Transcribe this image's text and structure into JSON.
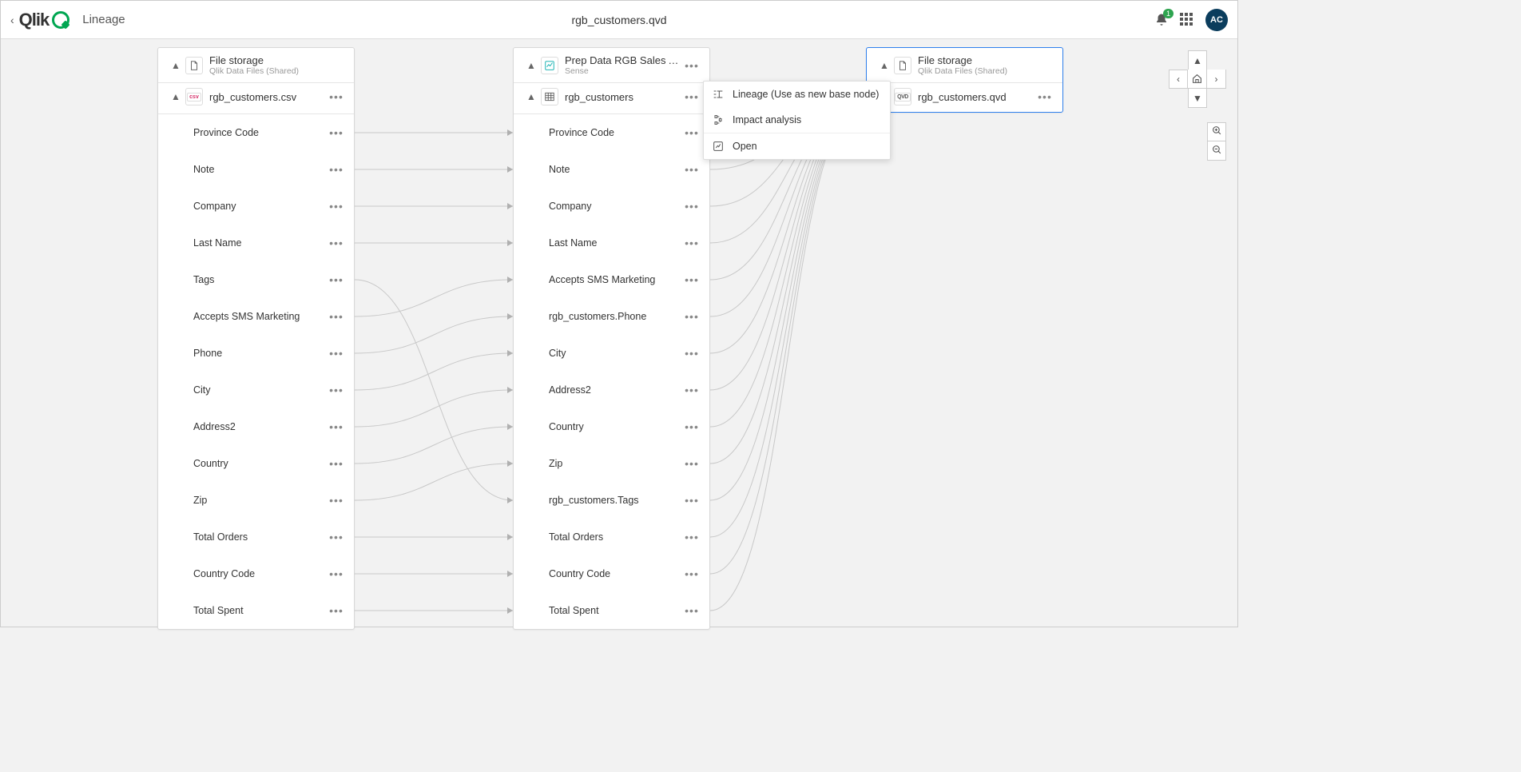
{
  "header": {
    "page_title": "Lineage",
    "document_title": "rgb_customers.qvd",
    "notification_count": "1",
    "avatar_initials": "AC"
  },
  "context_menu": {
    "items": [
      {
        "label": "Lineage (Use as new base node)"
      },
      {
        "label": "Impact analysis"
      },
      {
        "label": "Open"
      }
    ]
  },
  "nodes": {
    "left": {
      "title": "File storage",
      "subtitle": "Qlik Data Files (Shared)",
      "child_title": "rgb_customers.csv",
      "fields": [
        "Province Code",
        "Note",
        "Company",
        "Last Name",
        "Tags",
        "Accepts SMS Marketing",
        "Phone",
        "City",
        "Address2",
        "Country",
        "Zip",
        "Total Orders",
        "Country Code",
        "Total Spent"
      ]
    },
    "middle": {
      "title": "Prep Data RGB Sales A…",
      "subtitle": "Sense",
      "child_title": "rgb_customers",
      "fields": [
        "Province Code",
        "Note",
        "Company",
        "Last Name",
        "Accepts SMS Marketing",
        "rgb_customers.Phone",
        "City",
        "Address2",
        "Country",
        "Zip",
        "rgb_customers.Tags",
        "Total Orders",
        "Country Code",
        "Total Spent"
      ]
    },
    "right": {
      "title": "File storage",
      "subtitle": "Qlik Data Files (Shared)",
      "child_title": "rgb_customers.qvd"
    }
  }
}
